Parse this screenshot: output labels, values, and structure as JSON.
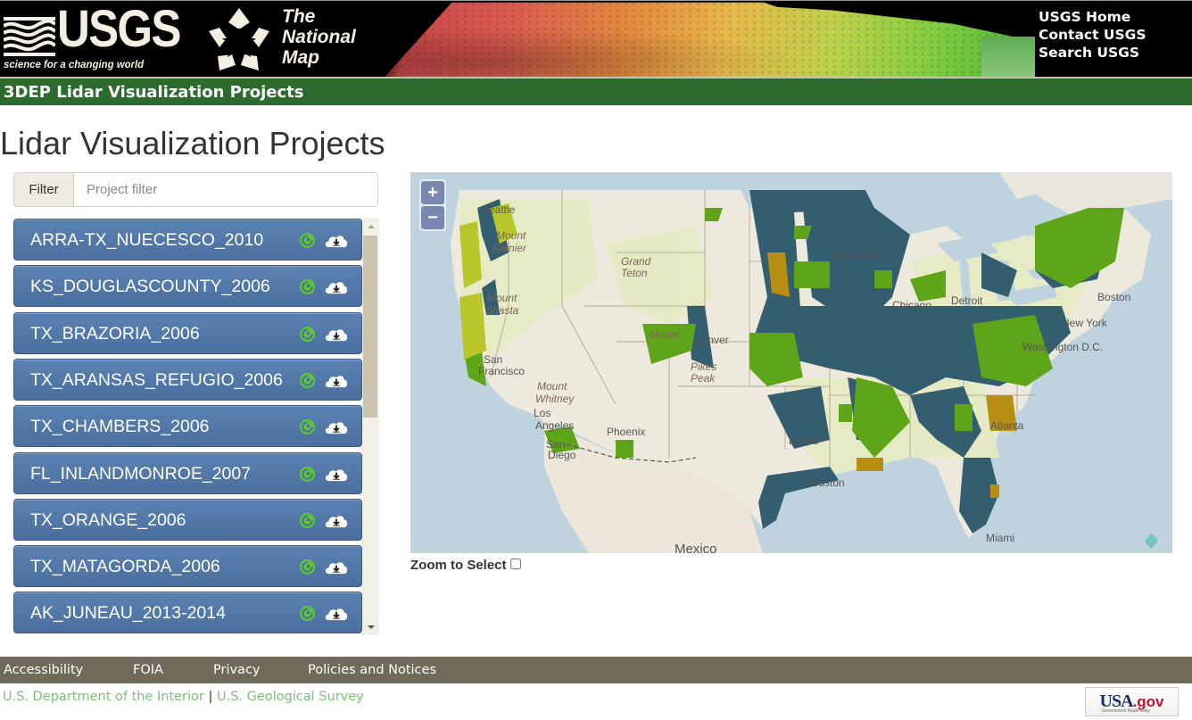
{
  "header": {
    "logo_text": "USGS",
    "logo_tagline": "science for a changing world",
    "tnm_lines": [
      "The",
      "National",
      "Map"
    ],
    "links": [
      "USGS Home",
      "Contact USGS",
      "Search USGS"
    ],
    "site_title": "3DEP Lidar Visualization Projects"
  },
  "main": {
    "page_title": "Lidar Visualization Projects",
    "filter": {
      "label": "Filter",
      "placeholder": "Project filter",
      "value": ""
    },
    "projects": [
      {
        "name": "ARRA-TX_NUECESCO_2010",
        "icons": [
          "visualize-icon",
          "cloud-download-icon"
        ]
      },
      {
        "name": "KS_DOUGLASCOUNTY_2006",
        "icons": [
          "visualize-icon",
          "cloud-download-icon"
        ]
      },
      {
        "name": "TX_BRAZORIA_2006",
        "icons": [
          "visualize-icon",
          "cloud-download-icon"
        ]
      },
      {
        "name": "TX_ARANSAS_REFUGIO_2006",
        "icons": [
          "visualize-icon",
          "cloud-download-icon"
        ]
      },
      {
        "name": "TX_CHAMBERS_2006",
        "icons": [
          "visualize-icon",
          "cloud-download-icon"
        ]
      },
      {
        "name": "FL_INLANDMONROE_2007",
        "icons": [
          "visualize-icon",
          "cloud-download-icon"
        ]
      },
      {
        "name": "TX_ORANGE_2006",
        "icons": [
          "visualize-icon",
          "cloud-download-icon"
        ]
      },
      {
        "name": "TX_MATAGORDA_2006",
        "icons": [
          "visualize-icon",
          "cloud-download-icon"
        ]
      },
      {
        "name": "AK_JUNEAU_2013-2014",
        "icons": [
          "visualize-icon",
          "cloud-download-icon"
        ]
      }
    ],
    "colors": {
      "project_button": "#4f75a6",
      "viz_icon": "#5cc43a",
      "header_green": "#2d6a2e",
      "footer_bar": "#706a5b",
      "footer_link": "#7cc07a"
    }
  },
  "map": {
    "zoom_in": "+",
    "zoom_out": "−",
    "labels": {
      "seattle": "Seattle",
      "mount_rainier_1": "Mount",
      "mount_rainier_2": "Rainier",
      "mount_shasta_1": "Mount",
      "mount_shasta_2": "Shasta",
      "grand_teton_1": "Grand",
      "grand_teton_2": "Teton",
      "san_francisco_1": "San",
      "san_francisco_2": "Francisco",
      "mount_whitney_1": "Mount",
      "mount_whitney_2": "Whitney",
      "los_angeles_1": "Los",
      "los_angeles_2": "Angeles",
      "san_diego_1": "San",
      "san_diego_2": "Diego",
      "phoenix": "Phoenix",
      "mount_elbert": "Mount",
      "denver": "Denver",
      "pikes_peak_1": "Pikes",
      "pikes_peak_2": "Peak",
      "minneapolis": "Minneapolis",
      "chicago": "Chicago",
      "detroit": "Detroit",
      "boston": "Boston",
      "new_york": "New York",
      "washington": "Washington D.C.",
      "atlanta": "Atlanta",
      "dallas": "Dallas",
      "houston": "Houston",
      "miami": "Miami",
      "mexico": "Mexico"
    },
    "legend_colors": {
      "coverage_dark": "#335e70",
      "coverage_green": "#5ea51a",
      "coverage_yellow": "#b9c62a",
      "coverage_orange": "#b88f12",
      "land": "#ede9dc",
      "forest": "#e7ecc0",
      "water": "#bed3de"
    },
    "zoom_to_select_label": "Zoom to Select",
    "zoom_to_select_checked": false
  },
  "footer": {
    "links": [
      "Accessibility",
      "FOIA",
      "Privacy",
      "Policies and Notices"
    ],
    "org_links": [
      "U.S. Department of the Interior",
      "U.S. Geological Survey"
    ],
    "separator": "|",
    "usagov": {
      "usa": "USA",
      "gov": ".gov",
      "tagline": "Government Made Easy"
    }
  }
}
